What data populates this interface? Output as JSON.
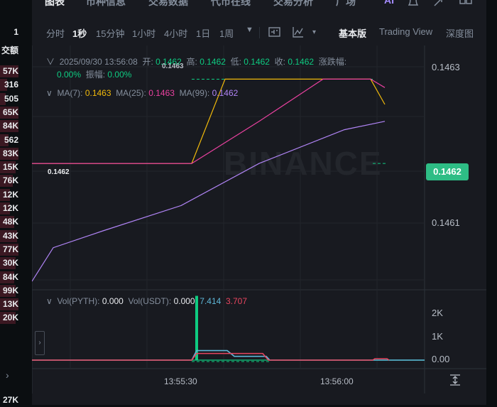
{
  "top_tabs": [
    "图表",
    "币种信息",
    "交易数据",
    "代币在线",
    "交易分析",
    "广场",
    "AI"
  ],
  "toolbar": {
    "intervals": [
      "分时",
      "1秒",
      "15分钟",
      "1小时",
      "4小时",
      "1日",
      "1周"
    ],
    "active_interval": "1秒",
    "views": [
      "基本版",
      "Trading View",
      "深度图"
    ],
    "active_view": "基本版"
  },
  "left_book": {
    "header_top": "1",
    "header": "交额",
    "rows": [
      "57K",
      "316",
      "505",
      "65K",
      "84K",
      "562",
      "83K",
      "15K",
      "76K",
      "12K",
      "12K",
      "48K",
      "43K",
      "77K",
      "30K",
      "84K",
      "99K",
      "13K",
      "20K"
    ],
    "bottom": "27K"
  },
  "ohlc": {
    "date": "2025/09/30 13:56:08",
    "open_label": "开:",
    "open": "0.1462",
    "high_label": "高:",
    "high": "0.1462",
    "low_label": "低:",
    "low": "0.1462",
    "close_label": "收:",
    "close": "0.1462",
    "change_label": "涨跌幅:",
    "change": "0.00%",
    "amplitude_label": "振幅:",
    "amplitude": "0.00%"
  },
  "ma": {
    "ma7_label": "MA(7):",
    "ma7": "0.1463",
    "ma25_label": "MA(25):",
    "ma25": "0.1463",
    "ma99_label": "MA(99):",
    "ma99": "0.1462"
  },
  "price_axis": [
    "0.1463",
    "0.1462",
    "0.1461"
  ],
  "current_price": "0.1462",
  "line_labels": {
    "high_marker": "0.1463",
    "low_marker": "0.1462"
  },
  "watermark": "BINANCE",
  "volume": {
    "vol_pyth_label": "Vol(PYTH):",
    "vol_pyth": "0.000",
    "vol_usdt_label": "Vol(USDT):",
    "vol_usdt": "0.000",
    "ma1": "7.414",
    "ma2": "3.707",
    "axis": [
      "2K",
      "1K",
      "0.00"
    ]
  },
  "time_axis": [
    "13:55:30",
    "13:56:00"
  ],
  "colors": {
    "up": "#0ecb81",
    "down": "#f6465d",
    "ma7": "#f0b90b",
    "ma25": "#e8419f",
    "ma99": "#b084f5",
    "vol_ma1": "#5eb7d8",
    "vol_ma2": "#e8455f"
  },
  "chart_data": {
    "type": "line",
    "title": "",
    "ylim": [
      0.14605,
      0.14634
    ],
    "series": [
      {
        "name": "MA(7)",
        "values": [
          0.1462,
          0.1462,
          0.1463,
          0.1463,
          0.1463,
          0.1463,
          0.14627
        ]
      },
      {
        "name": "MA(25)",
        "values": [
          0.1462,
          0.1462,
          0.14625,
          0.1463,
          0.1463,
          0.14629
        ]
      },
      {
        "name": "MA(99)",
        "values": [
          0.14606,
          0.1461,
          0.14612,
          0.14615,
          0.1462,
          0.14624,
          0.14625
        ]
      }
    ]
  }
}
